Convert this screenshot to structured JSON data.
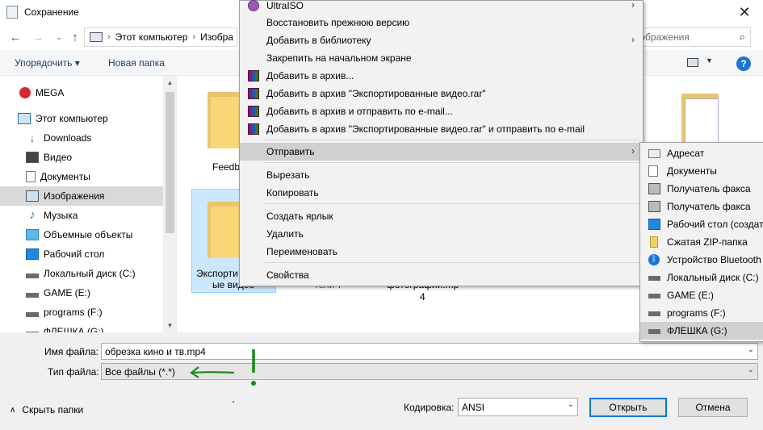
{
  "window": {
    "title": "Сохранение"
  },
  "nav": {
    "breadcrumb_pc": "Этот компьютер",
    "breadcrumb_folder": "Изобра",
    "search_placeholder": "зображения"
  },
  "toolbar": {
    "organize": "Упорядочить ▾",
    "new_folder": "Новая папка"
  },
  "sidebar": {
    "items": [
      {
        "label": "MEGA",
        "icon": "mega-icon"
      },
      {
        "label": "Этот компьютер",
        "icon": "computer-icon"
      },
      {
        "label": "Downloads",
        "icon": "download-icon"
      },
      {
        "label": "Видео",
        "icon": "video-icon"
      },
      {
        "label": "Документы",
        "icon": "document-icon"
      },
      {
        "label": "Изображения",
        "icon": "pictures-icon",
        "selected": true
      },
      {
        "label": "Музыка",
        "icon": "music-icon"
      },
      {
        "label": "Объемные объекты",
        "icon": "3d-objects-icon"
      },
      {
        "label": "Рабочий стол",
        "icon": "desktop-icon"
      },
      {
        "label": "Локальный диск (C:)",
        "icon": "drive-icon"
      },
      {
        "label": "GAME (E:)",
        "icon": "drive-icon"
      },
      {
        "label": "programs (F:)",
        "icon": "drive-icon"
      },
      {
        "label": "ФЛЕШКА (G:)",
        "icon": "drive-icon"
      }
    ]
  },
  "folders": {
    "feedback_label": "Feedb",
    "exported_label_1": "Экспорти",
    "exported_label_2": "ые видео",
    "third_label": "тели т",
    "fourth_label_1": "фотографии.mp",
    "fourth_label_2": "4"
  },
  "form": {
    "filename_label": "Имя файла:",
    "filename_value": "обрезка кино и тв.mp4",
    "filetype_label": "Тип файла:",
    "filetype_value": "Все файлы  (*.*)",
    "encoding_label": "Кодировка:",
    "encoding_value": "ANSI",
    "open_button": "Открыть",
    "cancel_button": "Отмена",
    "hide_folders": "Скрыть папки"
  },
  "context_menu": {
    "items": [
      {
        "label": "UltraISO",
        "icon": "ultraiso-icon",
        "submenu": true
      },
      {
        "label": "Восстановить прежнюю версию"
      },
      {
        "label": "Добавить в библиотеку",
        "submenu": true
      },
      {
        "label": "Закрепить на начальном экране"
      },
      {
        "label": "Добавить в архив...",
        "icon": "winrar-icon"
      },
      {
        "label": "Добавить в архив \"Экспортированные видео.rar\"",
        "icon": "winrar-icon"
      },
      {
        "label": "Добавить в архив и отправить по e-mail...",
        "icon": "winrar-icon"
      },
      {
        "label": "Добавить в архив \"Экспортированные видео.rar\" и отправить по e-mail",
        "icon": "winrar-icon"
      },
      {
        "label": "Отправить",
        "submenu": true,
        "hover": true
      },
      {
        "label": "Вырезать"
      },
      {
        "label": "Копировать"
      },
      {
        "label": "Создать ярлык"
      },
      {
        "label": "Удалить"
      },
      {
        "label": "Переименовать"
      },
      {
        "label": "Свойства"
      }
    ]
  },
  "send_to_menu": {
    "items": [
      {
        "label": "Адресат",
        "icon": "contact-icon"
      },
      {
        "label": "Документы",
        "icon": "document-icon"
      },
      {
        "label": "Получатель факса",
        "icon": "fax-icon"
      },
      {
        "label": "Получатель факса",
        "icon": "fax-icon"
      },
      {
        "label": "Рабочий стол (создат",
        "icon": "desktop-icon"
      },
      {
        "label": "Сжатая ZIP-папка",
        "icon": "zip-icon"
      },
      {
        "label": "Устройство Bluetooth",
        "icon": "bluetooth-icon"
      },
      {
        "label": "Локальный диск (C:)",
        "icon": "drive-icon"
      },
      {
        "label": "GAME (E:)",
        "icon": "drive-icon"
      },
      {
        "label": "programs (F:)",
        "icon": "drive-icon"
      },
      {
        "label": "ФЛЕШКА (G:)",
        "icon": "drive-icon",
        "hover": true
      }
    ]
  },
  "colors": {
    "accent": "#0078d7",
    "selection": "#cce8ff",
    "annotation": "#1a8a1a",
    "folder": "#f8d777"
  }
}
